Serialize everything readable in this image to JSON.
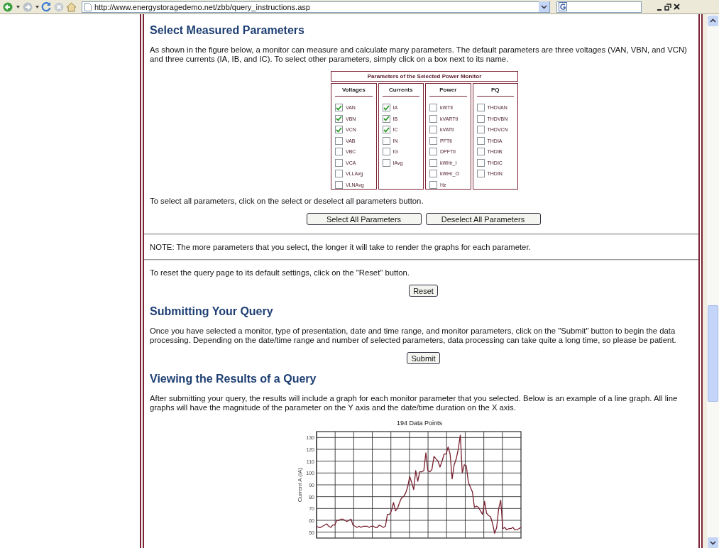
{
  "toolbar": {
    "address": "http://www.energystoragedemo.net/zbb/query_instructions.asp"
  },
  "content": [
    {
      "kind": "heading",
      "text": "Select Measured Parameters"
    },
    {
      "kind": "paragraph",
      "text": "As shown in the figure below, a monitor can measure and calculate many parameters. The default parameters are three voltages (VAN, VBN, and VCN) and three currents (IA, IB, and IC). To select other parameters, simply click on a box next to its name."
    },
    {
      "kind": "param_table",
      "title": "Parameters of the Selected Power Monitor",
      "columns": [
        {
          "heading": "Voltages",
          "items": [
            {
              "label": "VAN",
              "checked": true
            },
            {
              "label": "VBN",
              "checked": true
            },
            {
              "label": "VCN",
              "checked": true
            },
            {
              "label": "VAB",
              "checked": false
            },
            {
              "label": "VBC",
              "checked": false
            },
            {
              "label": "VCA",
              "checked": false
            },
            {
              "label": "VLLAvg",
              "checked": false
            },
            {
              "label": "VLNAvg",
              "checked": false
            }
          ]
        },
        {
          "heading": "Currents",
          "items": [
            {
              "label": "IA",
              "checked": true
            },
            {
              "label": "IB",
              "checked": true
            },
            {
              "label": "IC",
              "checked": true
            },
            {
              "label": "IN",
              "checked": false
            },
            {
              "label": "IG",
              "checked": false
            },
            {
              "label": "IAvg",
              "checked": false
            }
          ]
        },
        {
          "heading": "Power",
          "items": [
            {
              "label": "kWTtl",
              "checked": false
            },
            {
              "label": "kVARTtl",
              "checked": false
            },
            {
              "label": "kVATtl",
              "checked": false
            },
            {
              "label": "PFTtl",
              "checked": false
            },
            {
              "label": "DPFTtl",
              "checked": false
            },
            {
              "label": "kWHr_I",
              "checked": false
            },
            {
              "label": "kWHr_O",
              "checked": false
            },
            {
              "label": "Hz",
              "checked": false
            }
          ]
        },
        {
          "heading": "PQ",
          "items": [
            {
              "label": "THDVAN",
              "checked": false
            },
            {
              "label": "THDVBN",
              "checked": false
            },
            {
              "label": "THDVCN",
              "checked": false
            },
            {
              "label": "THDIA",
              "checked": false
            },
            {
              "label": "THDIB",
              "checked": false
            },
            {
              "label": "THDIC",
              "checked": false
            },
            {
              "label": "THDIN",
              "checked": false
            }
          ]
        }
      ]
    },
    {
      "kind": "paragraph",
      "text": "To select all parameters, click on the select or deselect all parameters button."
    },
    {
      "kind": "buttons",
      "buttons": [
        {
          "label": "Select All Parameters",
          "wide": true
        },
        {
          "label": "Deselect All Parameters",
          "wide": true
        }
      ]
    },
    {
      "kind": "rule"
    },
    {
      "kind": "paragraph",
      "text": "NOTE: The more parameters that you select, the longer it will take to render the graphs for each parameter."
    },
    {
      "kind": "rule"
    },
    {
      "kind": "paragraph",
      "text": "To reset the query page to its default settings, click on the \"Reset\" button."
    },
    {
      "kind": "buttons",
      "buttons": [
        {
          "label": "Reset",
          "wide": false
        }
      ]
    },
    {
      "kind": "heading",
      "text": "Submitting Your Query"
    },
    {
      "kind": "paragraph",
      "text": "Once you have selected a monitor, type of presentation, date and time range, and monitor parameters, click on the \"Submit\" button to begin the data processing. Depending on the date/time range and number of selected parameters, data processing can take quite a long time, so please be patient."
    },
    {
      "kind": "buttons",
      "buttons": [
        {
          "label": "Submit",
          "wide": false
        }
      ]
    },
    {
      "kind": "heading",
      "text": "Viewing the Results of a Query"
    },
    {
      "kind": "paragraph",
      "text": "After submitting your query, the results will include a graph for each monitor parameter that you selected. Below is an example of a line graph. All line graphs will have the magnitude of the parameter on the Y axis and the date/time duration on the X axis."
    },
    {
      "kind": "chart",
      "chart_data": {
        "type": "line",
        "grid": true,
        "title": "194 Data Points",
        "ylabel": "Current A (IA)",
        "ylim": [
          45,
          135
        ],
        "yticks": [
          50,
          60,
          70,
          80,
          90,
          100,
          110,
          120,
          130
        ],
        "series": [
          {
            "color": "#7a2030",
            "values": [
              55,
              54,
              54,
              55,
              56,
              57,
              55,
              54,
              56,
              56,
              60,
              60,
              61,
              61,
              60,
              59,
              60,
              61,
              56,
              55,
              54,
              55,
              54,
              55,
              55,
              55,
              54,
              55,
              55,
              54,
              54,
              56,
              55,
              54,
              55,
              65,
              65,
              68,
              75,
              68,
              70,
              75,
              79,
              80,
              83,
              88,
              97,
              92,
              86,
              102,
              93,
              101,
              101,
              102,
              117,
              102,
              101,
              103,
              114,
              112,
              110,
              105,
              110,
              116,
              116,
              122,
              116,
              95,
              107,
              112,
              120,
              132,
              100,
              107,
              106,
              92,
              88,
              84,
              71,
              72,
              71,
              68,
              65,
              76,
              66,
              64,
              63,
              57,
              49,
              54,
              70,
              77,
              53,
              54,
              52,
              53,
              53,
              54,
              52,
              52,
              53,
              54
            ]
          }
        ]
      }
    }
  ]
}
